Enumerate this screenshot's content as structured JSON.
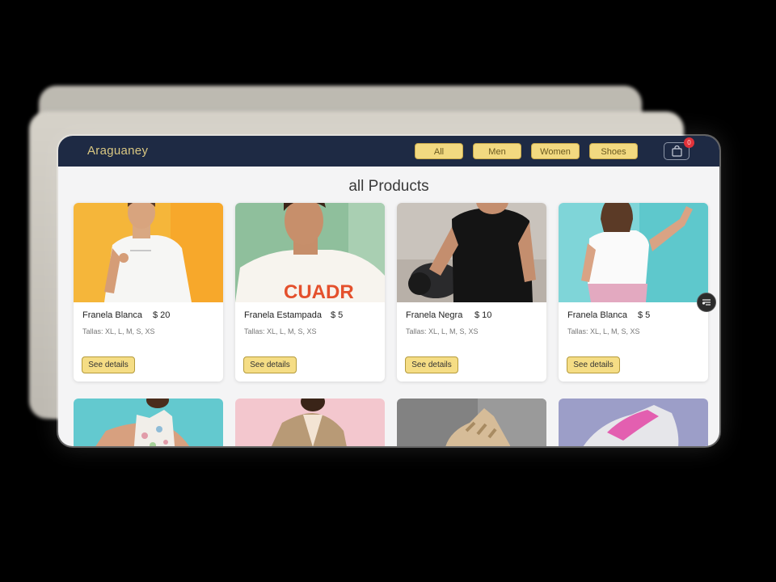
{
  "brand": "Araguaney",
  "nav": [
    "All",
    "Men",
    "Women",
    "Shoes"
  ],
  "cart": {
    "count": "0"
  },
  "page_title": "all Products",
  "products": [
    {
      "name": "Franela Blanca",
      "price": "$ 20",
      "sizes": "Tallas: XL, L, M, S, XS",
      "button": "See details"
    },
    {
      "name": "Franela Estampada",
      "price": "$ 5",
      "sizes": "Tallas: XL, L, M, S, XS",
      "button": "See details"
    },
    {
      "name": "Franela Negra",
      "price": "$ 10",
      "sizes": "Tallas: XL, L, M, S, XS",
      "button": "See details"
    },
    {
      "name": "Franela Blanca",
      "price": "$ 5",
      "sizes": "Tallas: XL, L, M, S, XS",
      "button": "See details"
    }
  ],
  "icons": {
    "cart": "shopping-bag-icon",
    "filter": "filter-icon"
  },
  "colors": {
    "navbar": "#1e2a44",
    "accent": "#f2d980",
    "badge": "#e0323a"
  }
}
